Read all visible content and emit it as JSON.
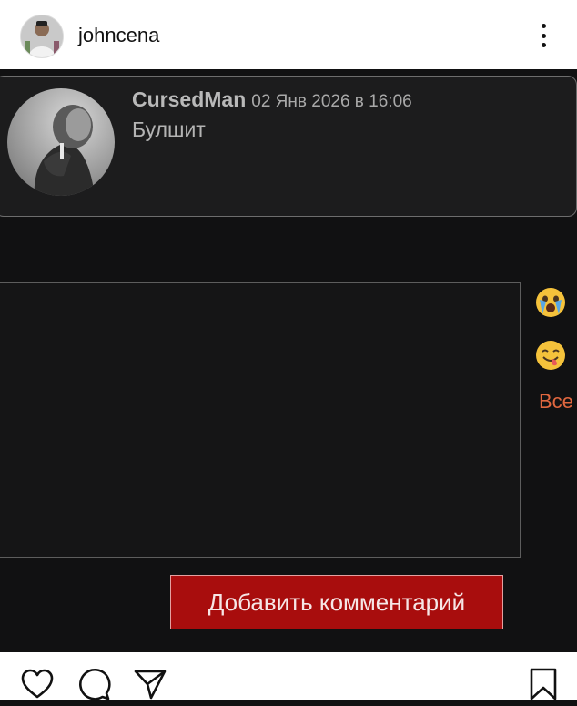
{
  "header": {
    "username": "johncena"
  },
  "comment": {
    "author": "CursedMan",
    "date": "02 Янв 2026 в 16:06",
    "text": "Булшит"
  },
  "emoji_panel": {
    "items": [
      "crying-face-emoji",
      "tongue-face-emoji"
    ],
    "all_label": "Все"
  },
  "form": {
    "submit_label": "Добавить комментарий"
  },
  "actions": {
    "icons": [
      "heart-icon",
      "comment-icon",
      "share-icon",
      "bookmark-icon"
    ]
  }
}
